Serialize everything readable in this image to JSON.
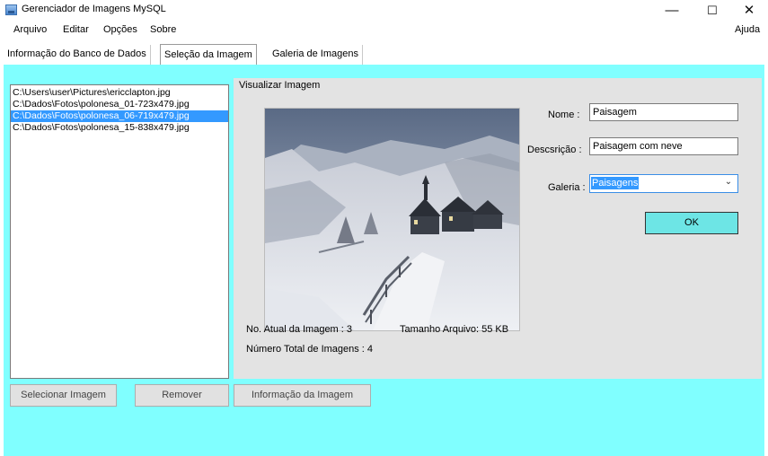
{
  "window": {
    "title": "Gerenciador de Imagens MySQL",
    "minimize": "—",
    "maximize": "☐",
    "close": "✕"
  },
  "menu": {
    "items": [
      "Arquivo",
      "Editar",
      "Opções",
      "Sobre"
    ],
    "help": "Ajuda"
  },
  "tabs": [
    {
      "label": "Informação do Banco de Dados",
      "active": false
    },
    {
      "label": "Seleção da Imagem",
      "active": true
    },
    {
      "label": "Galeria de Imagens",
      "active": false
    }
  ],
  "files": {
    "items": [
      "C:\\Users\\user\\Pictures\\ericclapton.jpg",
      "C:\\Dados\\Fotos\\polonesa_01-723x479.jpg",
      "C:\\Dados\\Fotos\\polonesa_06-719x479.jpg",
      "C:\\Dados\\Fotos\\polonesa_15-838x479.jpg"
    ],
    "selected_index": 2
  },
  "preview": {
    "group_title": "Visualizar Imagem",
    "current_label": "No. Atual da Imagem : 3",
    "size_label": "Tamanho Arquivo: 55 KB",
    "total_label": "Número Total de Imagens : 4",
    "image_icon": "snowy-mountain-cabin-photo"
  },
  "form": {
    "name_label": "Nome :",
    "name_value": "Paisagem",
    "desc_label": "Descsrição :",
    "desc_value": "Paisagem com neve",
    "gallery_label": "Galeria :",
    "gallery_value": "Paisagens",
    "ok_label": "OK"
  },
  "buttons": {
    "select": "Selecionar Imagem",
    "remove": "Remover",
    "info": "Informação da Imagem"
  },
  "colors": {
    "content_bg": "#80ffff",
    "selection": "#3399ff",
    "ok_button": "#6de5e5"
  }
}
